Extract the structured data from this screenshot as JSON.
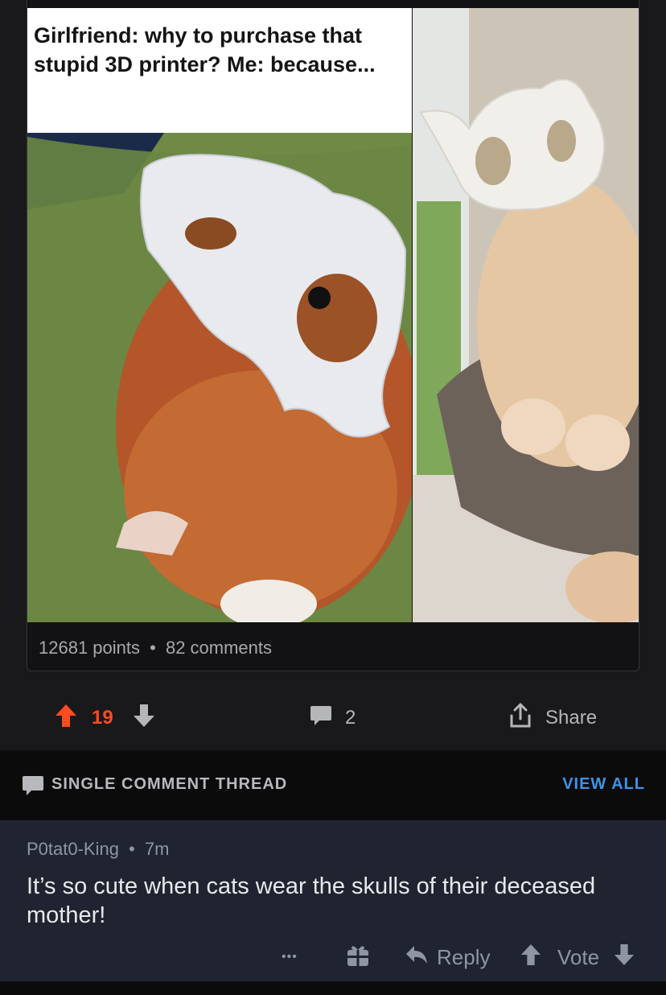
{
  "post": {
    "meme_caption": "Girlfriend: why to purchase that stupid 3D printer? Me: because...",
    "points": "12681 points",
    "separator": "•",
    "comments_count": "82 comments"
  },
  "actions": {
    "vote_score": "19",
    "comment_count": "2",
    "share_label": "Share"
  },
  "thread": {
    "title": "SINGLE COMMENT THREAD",
    "view_all": "VIEW ALL"
  },
  "comment": {
    "author": "P0tat0-King",
    "separator": "•",
    "age": "7m",
    "body": "It’s so cute when cats wear the skulls of their deceased mother!",
    "more_label": "•••",
    "reply_label": "Reply",
    "vote_label": "Vote"
  },
  "colors": {
    "upvote_active": "#ff4b1f",
    "link": "#3d93e6",
    "comment_bg": "#1f2430"
  },
  "icons": [
    "upvote-icon",
    "downvote-icon",
    "comment-icon",
    "share-icon",
    "chat-bubble-icon",
    "gift-icon",
    "reply-icon"
  ]
}
